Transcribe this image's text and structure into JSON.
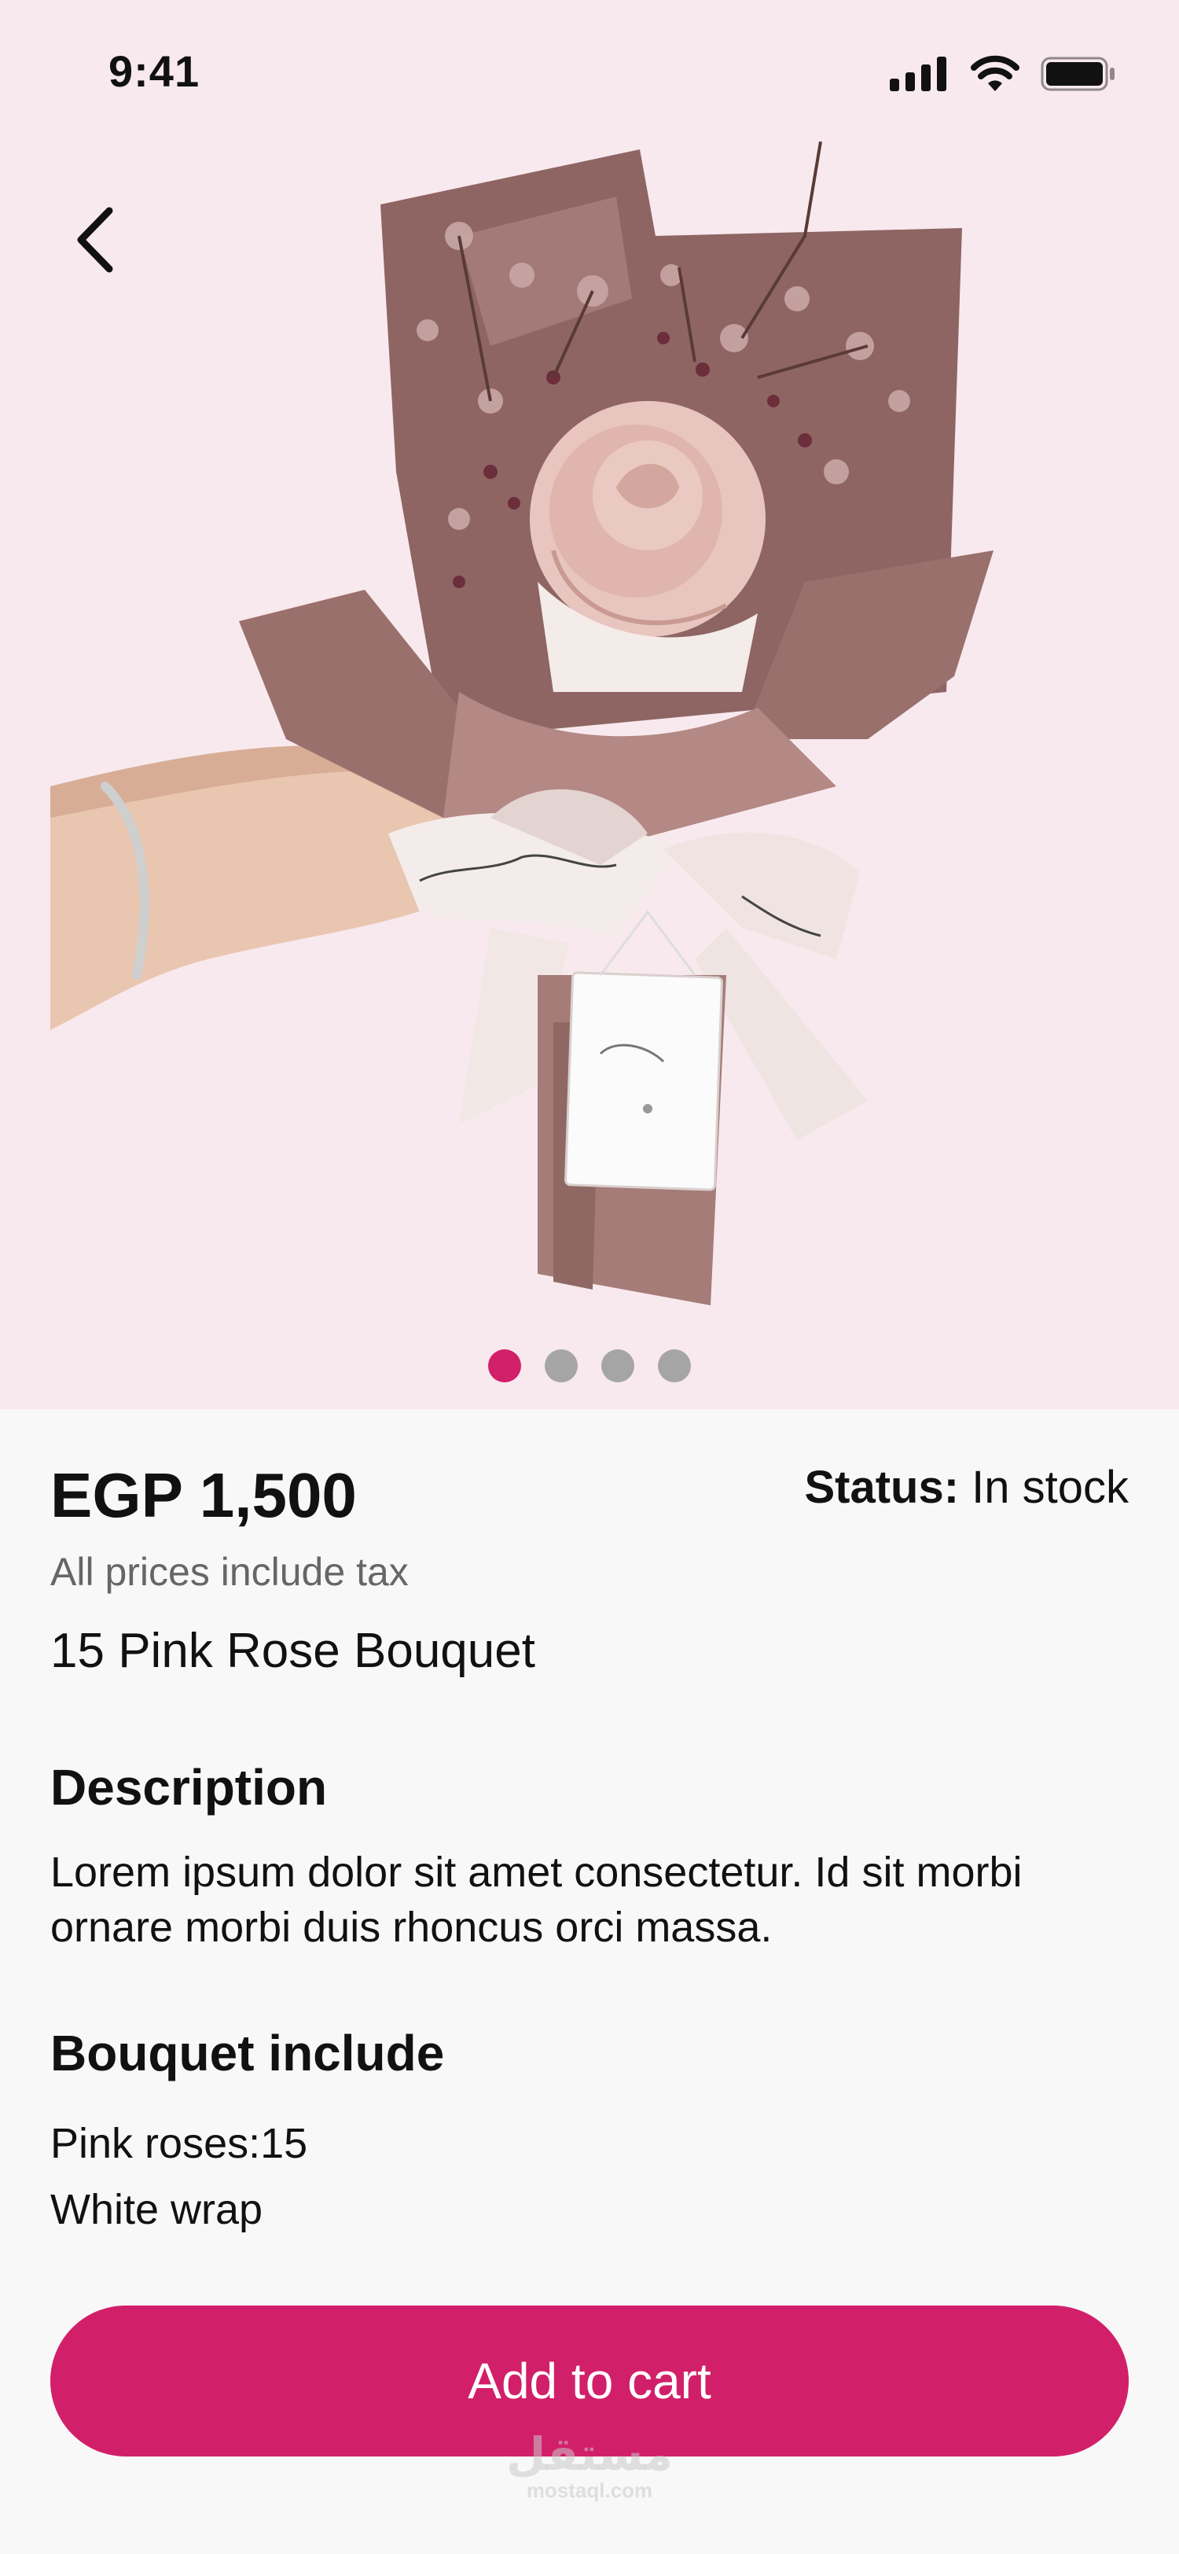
{
  "status_bar": {
    "time": "9:41",
    "icons": [
      "cellular-signal-icon",
      "wifi-icon",
      "battery-icon"
    ]
  },
  "navigation": {
    "back_icon": "chevron-left-icon"
  },
  "gallery": {
    "image_description": "Pink rose bouquet in mauve wrap held by hand",
    "page_count": 4,
    "active_index": 0
  },
  "product": {
    "price": "EGP 1,500",
    "status_label": "Status:",
    "status_value": "In stock",
    "tax_note": "All prices include tax",
    "name": "15 Pink Rose Bouquet"
  },
  "description": {
    "title": "Description",
    "text": "Lorem ipsum dolor sit amet consectetur. Id sit morbi ornare morbi duis rhoncus orci massa."
  },
  "bouquet_include": {
    "title": "Bouquet include",
    "items": [
      "Pink roses:15",
      "White wrap"
    ]
  },
  "cart": {
    "label": "Add to cart"
  },
  "watermark": {
    "logo": "مستقل",
    "text": "mostaql.com"
  },
  "colors": {
    "accent": "#d21f6a",
    "hero_bg": "#f8e9ee",
    "page_bg": "#f8f8f8",
    "dot_inactive": "#a5a5a5"
  }
}
